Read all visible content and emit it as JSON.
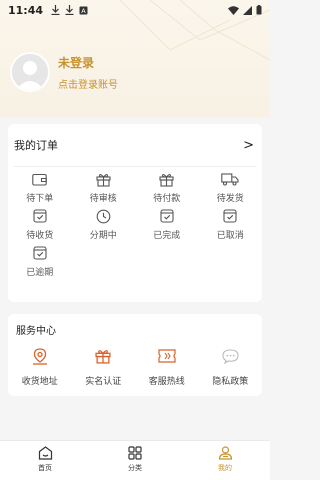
{
  "status_bar": {
    "time": "11:44",
    "left_icons": [
      "download-icon",
      "download-icon",
      "a-badge-icon"
    ],
    "right_icons": [
      "wifi-icon",
      "signal-icon",
      "battery-icon"
    ]
  },
  "profile": {
    "name": "未登录",
    "subtitle": "点击登录账号"
  },
  "orders": {
    "title": "我的订单",
    "more": ">",
    "items": [
      {
        "label": "待下单",
        "icon": "wallet-icon"
      },
      {
        "label": "待审核",
        "icon": "gift-icon"
      },
      {
        "label": "待付款",
        "icon": "gift-icon"
      },
      {
        "label": "待发货",
        "icon": "truck-icon"
      },
      {
        "label": "待收货",
        "icon": "check-box-icon"
      },
      {
        "label": "分期中",
        "icon": "clock-icon"
      },
      {
        "label": "已完成",
        "icon": "check-box-icon"
      },
      {
        "label": "已取消",
        "icon": "check-box-icon"
      },
      {
        "label": "已逾期",
        "icon": "check-box-icon"
      }
    ]
  },
  "services": {
    "title": "服务中心",
    "items": [
      {
        "label": "收货地址",
        "icon": "location-icon"
      },
      {
        "label": "实名认证",
        "icon": "gift-icon"
      },
      {
        "label": "客服热线",
        "icon": "ticket-icon"
      },
      {
        "label": "隐私政策",
        "icon": "chat-icon"
      }
    ]
  },
  "tabbar": {
    "items": [
      {
        "label": "首页",
        "icon": "home-icon"
      },
      {
        "label": "分类",
        "icon": "grid-icon"
      },
      {
        "label": "我的",
        "icon": "user-icon"
      }
    ],
    "active": "我的"
  },
  "colors": {
    "accent": "#c8922e",
    "service_icon": "#d9622b",
    "icon_gray": "#555555"
  }
}
